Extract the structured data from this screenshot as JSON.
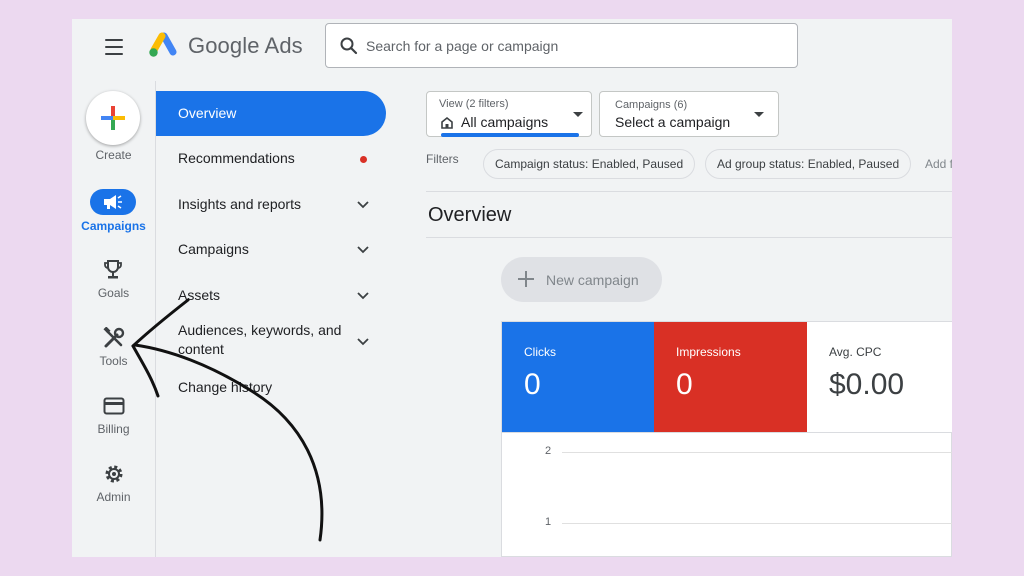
{
  "header": {
    "brand": "Google Ads",
    "search_placeholder": "Search for a page or campaign"
  },
  "rail": {
    "create": "Create",
    "campaigns": "Campaigns",
    "goals": "Goals",
    "tools": "Tools",
    "billing": "Billing",
    "admin": "Admin"
  },
  "nav": {
    "items": [
      {
        "label": "Overview"
      },
      {
        "label": "Recommendations"
      },
      {
        "label": "Insights and reports"
      },
      {
        "label": "Campaigns"
      },
      {
        "label": "Assets"
      },
      {
        "label_line1": "Audiences, keywords, and",
        "label_line2": "content"
      },
      {
        "label": "Change history"
      }
    ]
  },
  "main": {
    "view_label": "View (2 filters)",
    "view_value": "All campaigns",
    "campaigns_label": "Campaigns (6)",
    "campaigns_value": "Select a campaign",
    "filters_label": "Filters",
    "chips": [
      "Campaign status: Enabled, Paused",
      "Ad group status: Enabled, Paused"
    ],
    "add_filter": "Add f",
    "title": "Overview",
    "new_campaign": "New campaign",
    "metrics": [
      {
        "label": "Clicks",
        "value": "0",
        "color": "#1a73e8"
      },
      {
        "label": "Impressions",
        "value": "0",
        "color": "#d93025"
      },
      {
        "label": "Avg. CPC",
        "value": "$0.00",
        "color": "#ffffff"
      }
    ],
    "chart_ticks": [
      "2",
      "1"
    ]
  },
  "colors": {
    "accent": "#1a73e8",
    "red": "#d93025"
  }
}
